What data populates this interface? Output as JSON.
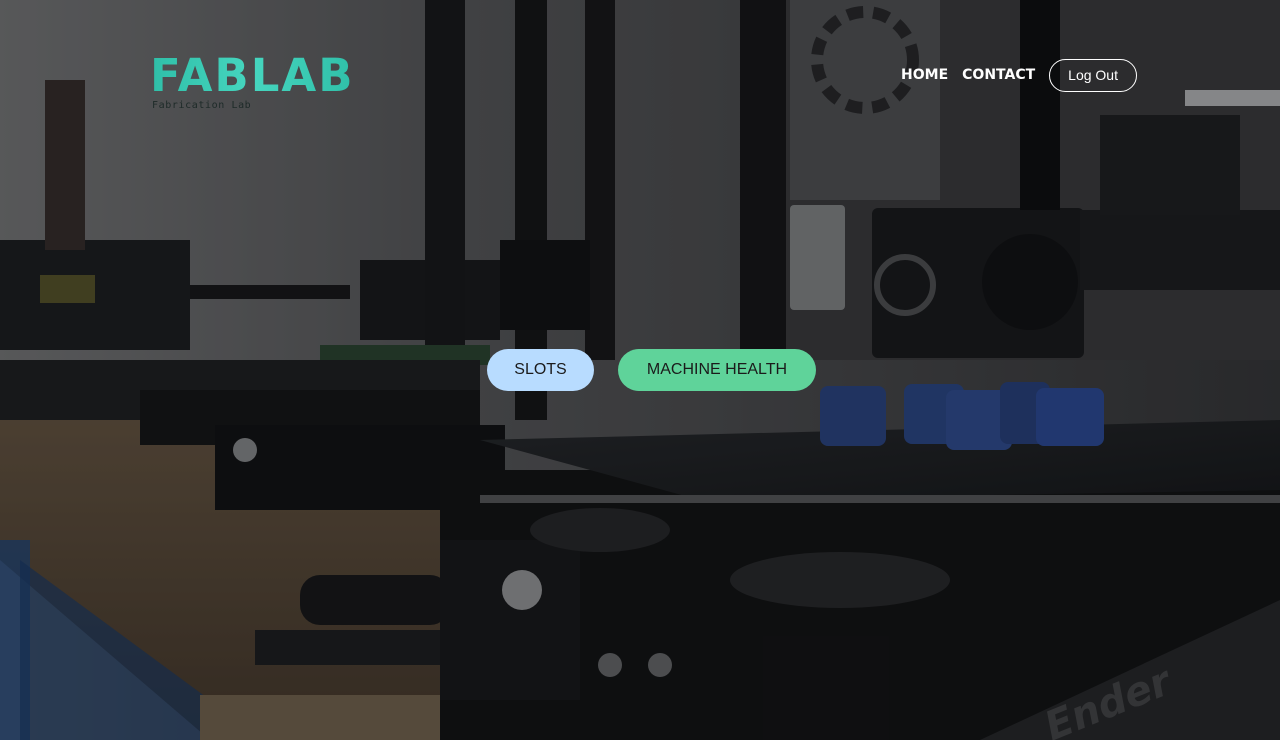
{
  "brand": {
    "logo_text": "FABLAB",
    "logo_subtitle": "Fabrication Lab",
    "logo_color": "#3bc8b0"
  },
  "nav": {
    "home_label": "HOME",
    "contact_label": "CONTACT",
    "logout_label": "Log Out"
  },
  "actions": {
    "slots": {
      "label": "SLOTS",
      "color": "#b8dcff"
    },
    "machine_health": {
      "label": "MACHINE HEALTH",
      "color": "#5fd39a"
    }
  },
  "hero": {
    "printer_brand_label": "Ender"
  }
}
